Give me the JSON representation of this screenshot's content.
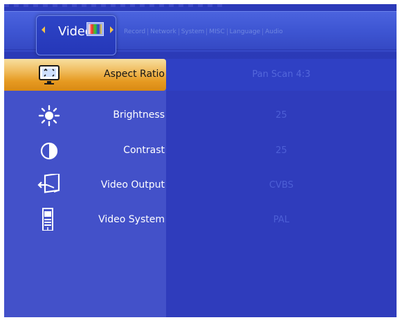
{
  "header": {
    "active_tab": "Video",
    "tabs": [
      "Record",
      "Network",
      "System",
      "MISC",
      "Language",
      "Audio"
    ]
  },
  "settings": [
    {
      "label": "Aspect Ratio",
      "value": "Pan Scan 4:3",
      "icon": "aspect-ratio-icon",
      "selected": true
    },
    {
      "label": "Brightness",
      "value": "25",
      "icon": "brightness-icon"
    },
    {
      "label": "Contrast",
      "value": "25",
      "icon": "contrast-icon"
    },
    {
      "label": "Video Output",
      "value": "CVBS",
      "icon": "video-output-icon"
    },
    {
      "label": "Video System",
      "value": "PAL",
      "icon": "video-system-icon"
    }
  ],
  "colors": {
    "selection": "#f1bf63",
    "background": "#2b3ab8",
    "label": "#ffffff",
    "value": "#4d5fd6"
  }
}
